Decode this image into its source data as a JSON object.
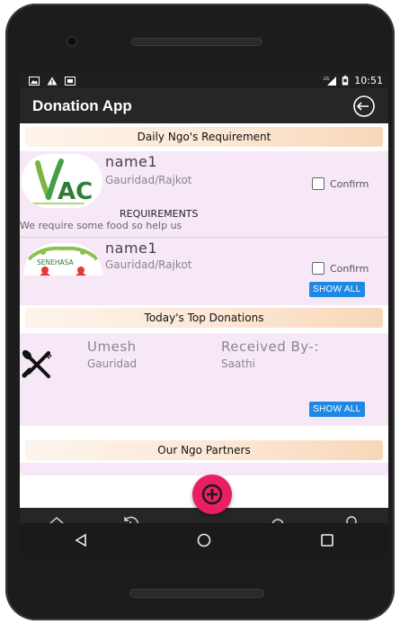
{
  "status_bar": {
    "time": "10:51",
    "network": "LTE"
  },
  "app_bar": {
    "title": "Donation App"
  },
  "sections": {
    "requirements_title": "Daily Ngo's Requirement",
    "top_donations_title": "Today's Top Donations",
    "partners_title": "Our Ngo Partners"
  },
  "requirements": [
    {
      "name": "name1",
      "location": "Gauridad/Rajkot",
      "confirm_label": "Confirm",
      "requirements_label": "REQUIREMENTS",
      "requirement_text": "We require some food so help us",
      "logo_text": "AC"
    },
    {
      "name": "name1",
      "location": "Gauridad/Rajkot",
      "confirm_label": "Confirm",
      "logo_text": "SENEHASA"
    }
  ],
  "show_all_label": "SHOW ALL",
  "donation": {
    "donor_name": "Umesh",
    "donor_location": "Gauridad",
    "received_label": "Received By-:",
    "receiver": "Saathi"
  },
  "icons": {
    "home": "home-icon",
    "history": "history-icon",
    "add": "add-icon",
    "notifications": "bell-icon",
    "profile": "user-icon",
    "logout": "logout-icon"
  },
  "colors": {
    "appbar": "#262626",
    "card": "#f7e8f7",
    "section_header": "#fce6d2",
    "show_all": "#1e88e5",
    "fab": "#e91e63"
  }
}
